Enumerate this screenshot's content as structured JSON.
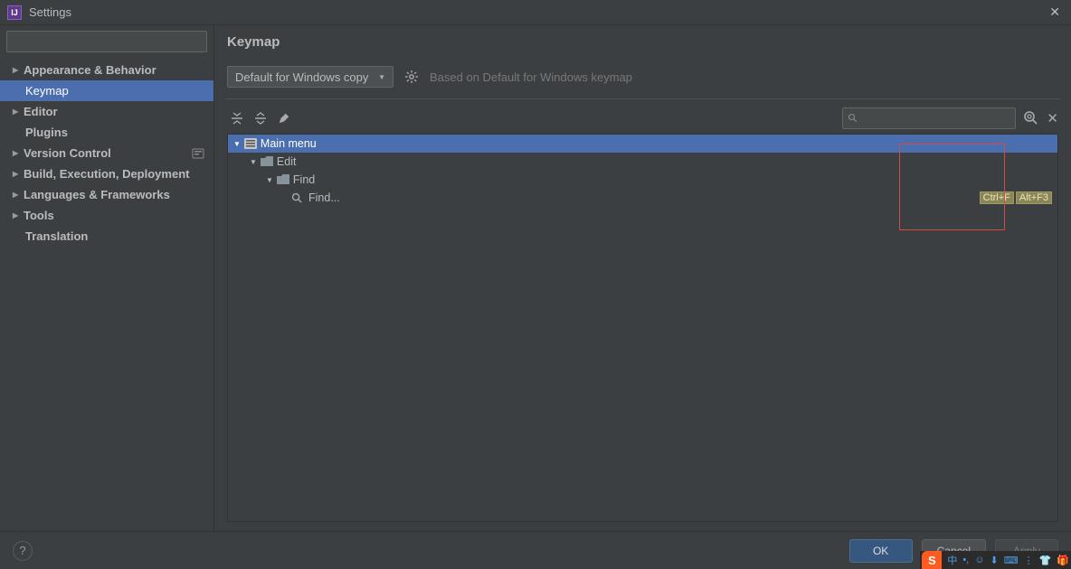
{
  "window": {
    "title": "Settings"
  },
  "sidebar": {
    "search_placeholder": "",
    "items": [
      {
        "label": "Appearance & Behavior",
        "expandable": true,
        "selected": false
      },
      {
        "label": "Keymap",
        "expandable": false,
        "selected": true
      },
      {
        "label": "Editor",
        "expandable": true,
        "selected": false
      },
      {
        "label": "Plugins",
        "expandable": false,
        "selected": false
      },
      {
        "label": "Version Control",
        "expandable": true,
        "selected": false,
        "badge": "project"
      },
      {
        "label": "Build, Execution, Deployment",
        "expandable": true,
        "selected": false
      },
      {
        "label": "Languages & Frameworks",
        "expandable": true,
        "selected": false
      },
      {
        "label": "Tools",
        "expandable": true,
        "selected": false
      },
      {
        "label": "Translation",
        "expandable": false,
        "selected": false
      }
    ]
  },
  "keymap": {
    "title": "Keymap",
    "scheme": "Default for Windows copy",
    "based_on": "Based on Default for Windows keymap",
    "search_placeholder": "",
    "tree": {
      "main_menu": "Main menu",
      "edit": "Edit",
      "find_group": "Find",
      "find_action": "Find...",
      "shortcuts": [
        "Ctrl+F",
        "Alt+F3"
      ]
    }
  },
  "footer": {
    "ok": "OK",
    "cancel": "Cancel",
    "apply": "Apply"
  },
  "ime": {
    "items": [
      "中",
      "•,",
      "☺",
      "⬇",
      "⌨",
      "⋮",
      "👕",
      "🎁"
    ]
  }
}
